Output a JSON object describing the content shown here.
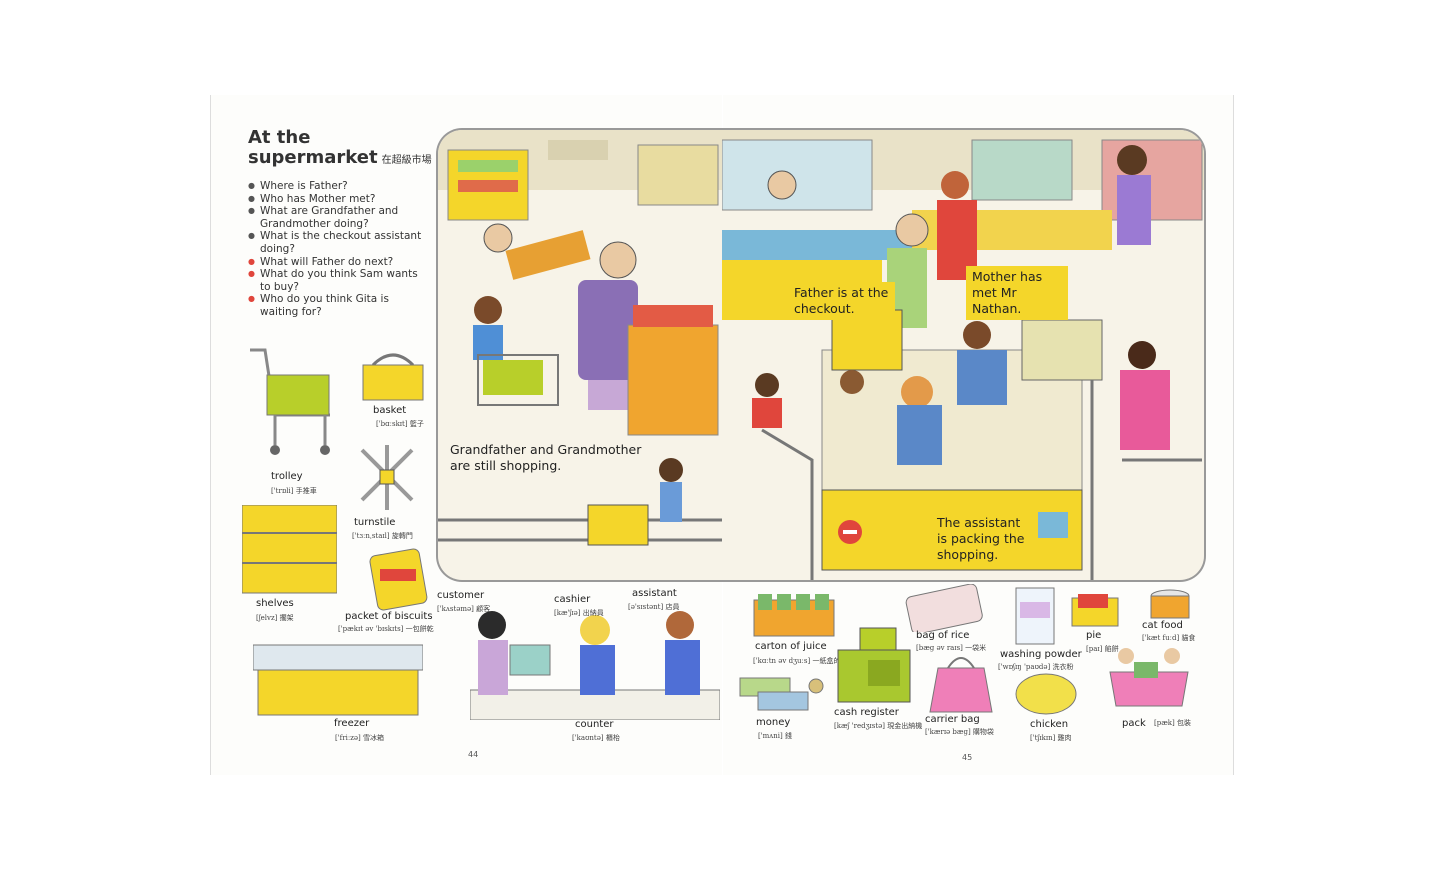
{
  "title": {
    "line1": "At the",
    "line2": "supermarket",
    "zh": "在超級市場"
  },
  "questions": [
    {
      "text": "Where is Father?",
      "red": false
    },
    {
      "text": "Who has Mother met?",
      "red": false
    },
    {
      "text": "What are Grandfather and Grandmother doing?",
      "red": false
    },
    {
      "text": "What is the checkout assistant doing?",
      "red": false
    },
    {
      "text": "What will Father do next?",
      "red": true
    },
    {
      "text": "What do you think Sam wants to buy?",
      "red": true
    },
    {
      "text": "Who do you think Gita is waiting for?",
      "red": true
    }
  ],
  "captions": {
    "grandparents": "Grandfather and Grandmother are still shopping.",
    "father": "Father is at the checkout.",
    "mother": "Mother has met Mr Nathan.",
    "assistant": "The assistant is packing the shopping."
  },
  "vocab": {
    "trolley": {
      "word": "trolley",
      "ph": "['trɒli] 手推車"
    },
    "basket": {
      "word": "basket",
      "ph": "['bɑːskɪt] 籃子"
    },
    "turnstile": {
      "word": "turnstile",
      "ph": "['tɜːnˌstaɪl] 旋轉門"
    },
    "shelves": {
      "word": "shelves",
      "ph": "[ʃelvz] 擱架"
    },
    "biscuits": {
      "word": "packet of biscuits",
      "ph": "['pækɪt əv 'bɪskɪts] 一包餅乾"
    },
    "freezer": {
      "word": "freezer",
      "ph": "['friːzə] 雪冰箱"
    },
    "customer": {
      "word": "customer",
      "ph": "['kʌstəmə] 顧客"
    },
    "cashier": {
      "word": "cashier",
      "ph": "[kæ'ʃɪə] 出納員"
    },
    "assistant": {
      "word": "assistant",
      "ph": "[ə'sɪstənt] 店員"
    },
    "counter": {
      "word": "counter",
      "ph": "['kaʊntə] 櫃枱"
    },
    "juice": {
      "word": "carton of juice",
      "ph": "['kɑːtn əv dʒuːs] 一紙盒的果汁"
    },
    "money": {
      "word": "money",
      "ph": "['mʌni] 錢"
    },
    "register": {
      "word": "cash register",
      "ph": "[kæʃ 'redʒɪstə] 現金出納機"
    },
    "rice": {
      "word": "bag of rice",
      "ph": "[bæg əv raɪs] 一袋米"
    },
    "carrier": {
      "word": "carrier bag",
      "ph": "['kærɪə bæg] 購物袋"
    },
    "powder": {
      "word": "washing powder",
      "ph": "['wɒʃɪŋ 'paʊdə] 洗衣粉"
    },
    "pie": {
      "word": "pie",
      "ph": "[paɪ] 餡餅"
    },
    "catfood": {
      "word": "cat food",
      "ph": "['kæt fuːd] 貓食"
    },
    "chicken": {
      "word": "chicken",
      "ph": "['tʃɪkɪn] 雞肉"
    },
    "pack": {
      "word": "pack",
      "ph": "[pæk] 包裝"
    }
  },
  "pages": {
    "left": "44",
    "right": "45"
  },
  "colors": {
    "accent_yellow": "#f4d62a",
    "basket_green": "#b8cf2a",
    "red_bullet": "#e0463c"
  }
}
